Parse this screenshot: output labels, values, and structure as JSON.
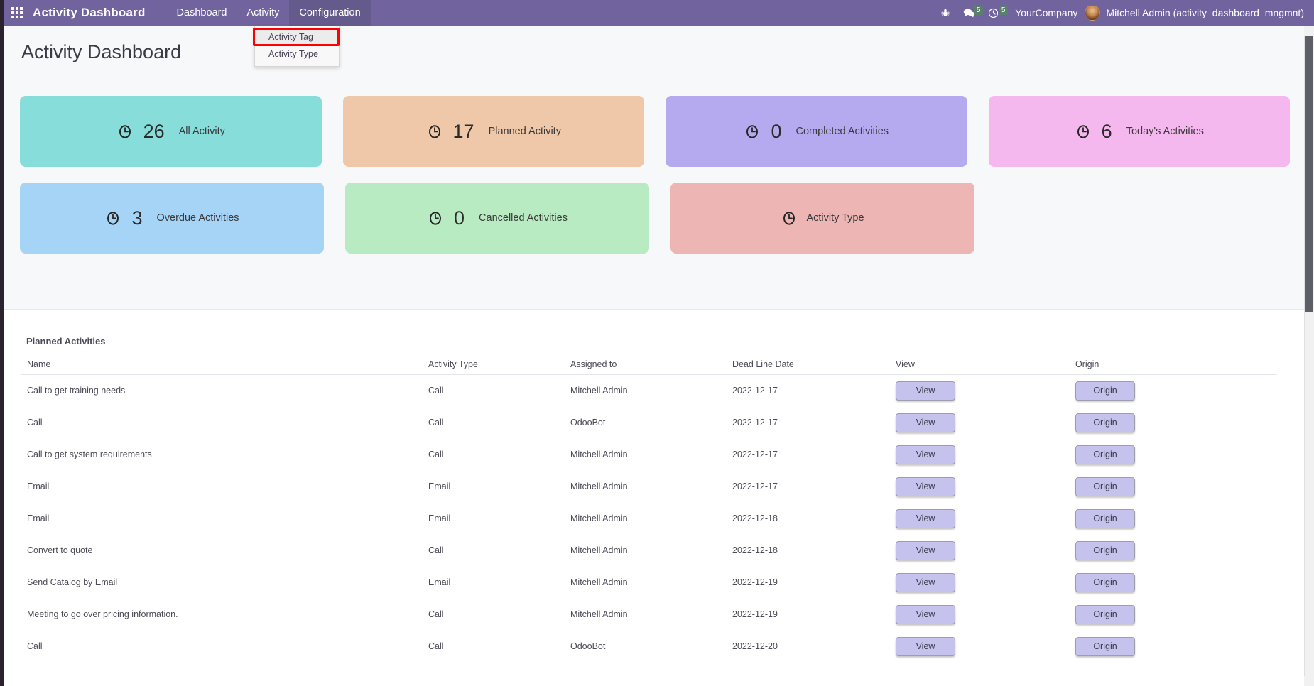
{
  "navbar": {
    "apps_icon": "apps-grid-icon",
    "brand": "Activity Dashboard",
    "menu": [
      {
        "label": "Dashboard",
        "active": false
      },
      {
        "label": "Activity",
        "active": false
      },
      {
        "label": "Configuration",
        "active": true
      }
    ],
    "icons": {
      "bug": "bug-icon",
      "messages": "chat-bubble-icon",
      "messages_count": "5",
      "activities": "clock-icon",
      "activities_count": "5"
    },
    "company": "YourCompany",
    "username": "Mitchell Admin (activity_dashboard_mngmnt)",
    "avatar": "user-avatar"
  },
  "dropdown": {
    "items": [
      {
        "label": "Activity Tag",
        "hovered": true,
        "highlighted": true
      },
      {
        "label": "Activity Type",
        "hovered": false,
        "highlighted": false
      }
    ]
  },
  "page": {
    "title": "Activity Dashboard"
  },
  "cards": [
    {
      "value": "26",
      "label": "All Activity",
      "color": "#87ddd9",
      "icon": "clock-icon",
      "has_value": true
    },
    {
      "value": "17",
      "label": "Planned Activity",
      "color": "#eec8a8",
      "icon": "clock-icon",
      "has_value": true
    },
    {
      "value": "0",
      "label": "Completed Activities",
      "color": "#b5aaf0",
      "icon": "clock-icon",
      "has_value": true
    },
    {
      "value": "6",
      "label": "Today's Activities",
      "color": "#f5b8ee",
      "icon": "clock-icon",
      "has_value": true
    },
    {
      "value": "3",
      "label": "Overdue Activities",
      "color": "#a6d4f7",
      "icon": "clock-icon",
      "has_value": true
    },
    {
      "value": "0",
      "label": "Cancelled Activities",
      "color": "#b8ebc2",
      "icon": "clock-icon",
      "has_value": true
    },
    {
      "value": "",
      "label": "Activity Type",
      "color": "#eeb5b5",
      "icon": "clock-icon",
      "has_value": false
    }
  ],
  "table": {
    "caption": "Planned Activities",
    "columns": [
      "Name",
      "Activity Type",
      "Assigned to",
      "Dead Line Date",
      "View",
      "Origin"
    ],
    "view_label": "View",
    "origin_label": "Origin",
    "rows": [
      {
        "name": "Call to get training needs",
        "type": "Call",
        "assigned": "Mitchell Admin",
        "deadline": "2022-12-17"
      },
      {
        "name": "Call",
        "type": "Call",
        "assigned": "OdooBot",
        "deadline": "2022-12-17"
      },
      {
        "name": "Call to get system requirements",
        "type": "Call",
        "assigned": "Mitchell Admin",
        "deadline": "2022-12-17"
      },
      {
        "name": "Email",
        "type": "Email",
        "assigned": "Mitchell Admin",
        "deadline": "2022-12-17"
      },
      {
        "name": "Email",
        "type": "Email",
        "assigned": "Mitchell Admin",
        "deadline": "2022-12-18"
      },
      {
        "name": "Convert to quote",
        "type": "Call",
        "assigned": "Mitchell Admin",
        "deadline": "2022-12-18"
      },
      {
        "name": "Send Catalog by Email",
        "type": "Email",
        "assigned": "Mitchell Admin",
        "deadline": "2022-12-19"
      },
      {
        "name": "Meeting to go over pricing information.",
        "type": "Call",
        "assigned": "Mitchell Admin",
        "deadline": "2022-12-19"
      },
      {
        "name": "Call",
        "type": "Call",
        "assigned": "OdooBot",
        "deadline": "2022-12-20"
      }
    ]
  },
  "colors": {
    "navbar": "#71639e",
    "navbar_active": "#655a8c",
    "page_bg": "#f7f8fa",
    "panel_bg": "#ffffff",
    "button": "#c5c2ee",
    "highlight_box": "#ff0000",
    "badge": "#5b7f6d"
  }
}
